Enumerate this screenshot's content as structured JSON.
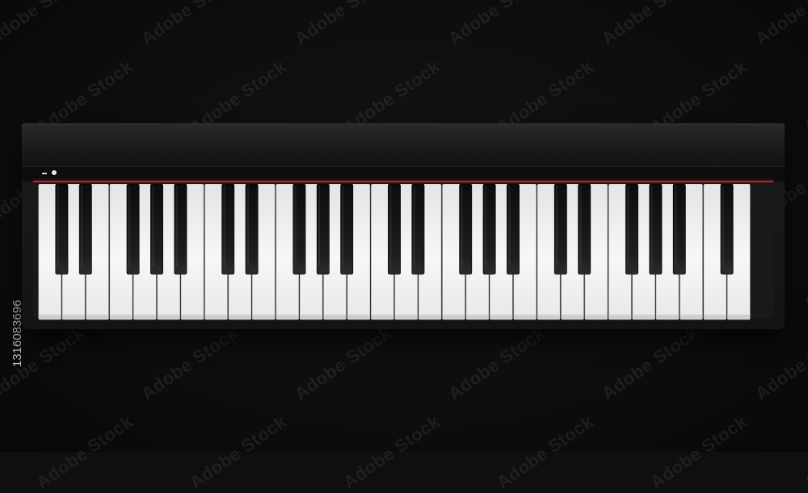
{
  "watermark": {
    "text": "Adobe Stock"
  },
  "stock_id": "1316083696",
  "keyboard": {
    "white_key_count": 30,
    "black_pattern": [
      1,
      1,
      0,
      1,
      1,
      1,
      0
    ],
    "colors": {
      "accent_line": "#c0202a",
      "white_key": "#f2f2f2",
      "black_key": "#161617",
      "body": "#1b1b1c"
    }
  }
}
